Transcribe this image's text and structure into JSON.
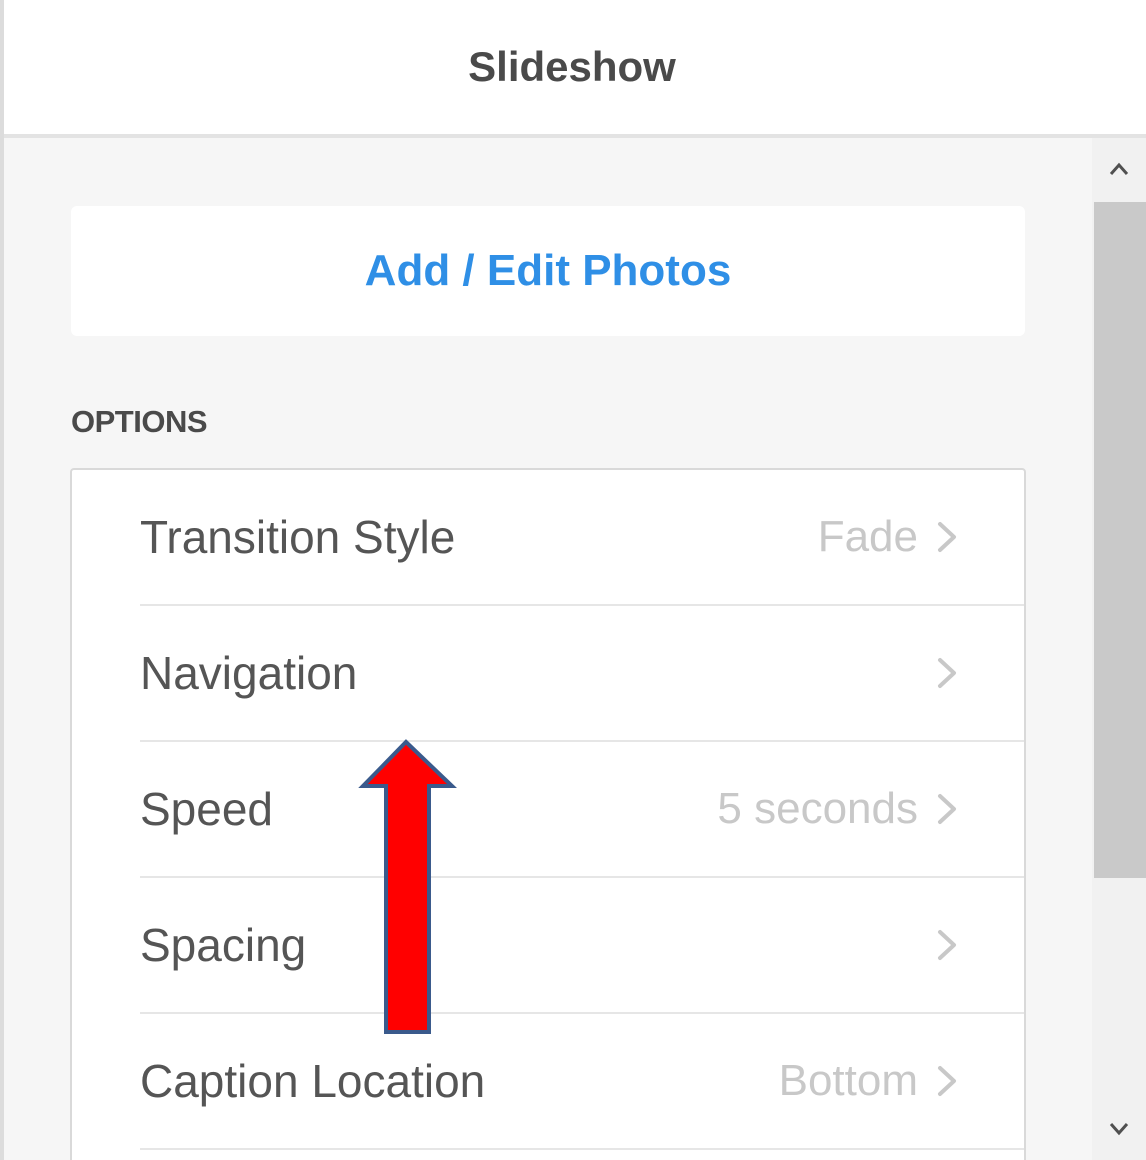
{
  "header": {
    "title": "Slideshow"
  },
  "add_photos": {
    "label": "Add / Edit Photos"
  },
  "options": {
    "heading": "OPTIONS",
    "items": [
      {
        "label": "Transition Style",
        "value": "Fade"
      },
      {
        "label": "Navigation",
        "value": ""
      },
      {
        "label": "Speed",
        "value": "5 seconds"
      },
      {
        "label": "Spacing",
        "value": ""
      },
      {
        "label": "Caption Location",
        "value": "Bottom"
      }
    ]
  },
  "scrollbar": {
    "up_icon": "chevron-up-icon",
    "down_icon": "chevron-down-icon"
  },
  "annotation": {
    "icon": "up-arrow-icon",
    "fill_color": "#ff0000",
    "stroke_color": "#3a5a8c"
  },
  "colors": {
    "accent": "#2f8fe6",
    "value_text": "#c8c8c8",
    "label_text": "#555555"
  }
}
